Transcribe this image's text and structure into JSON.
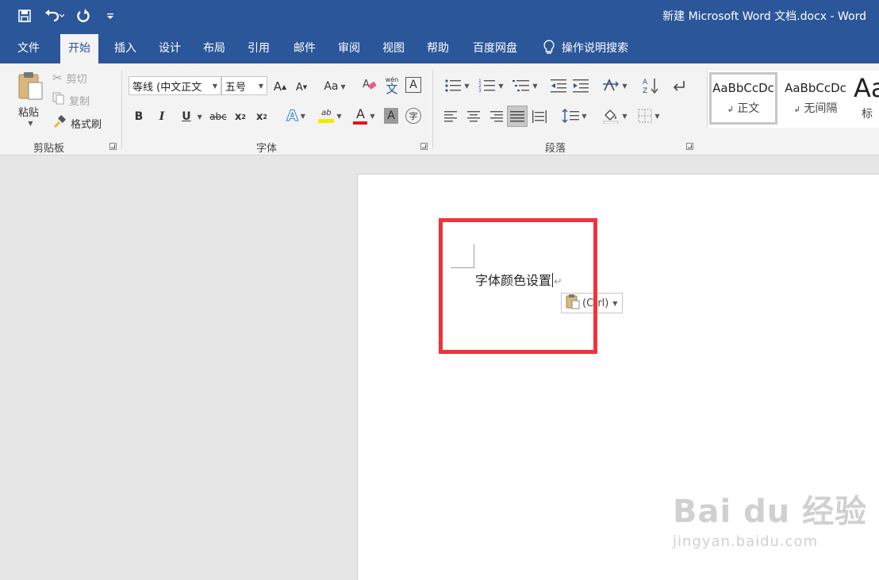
{
  "window": {
    "title": "新建 Microsoft Word 文档.docx  -  Word"
  },
  "tabs": [
    "文件",
    "开始",
    "插入",
    "设计",
    "布局",
    "引用",
    "邮件",
    "审阅",
    "视图",
    "帮助",
    "百度网盘"
  ],
  "active_tab": "开始",
  "tell_me": "操作说明搜索",
  "clipboard": {
    "paste": "粘贴",
    "cut": "剪切",
    "copy": "复制",
    "format_painter": "格式刷",
    "label": "剪贴板"
  },
  "font": {
    "name": "等线 (中文正文",
    "size": "五号",
    "grow": "A",
    "shrink": "A",
    "case": "Aa",
    "phonetic_top": "wén",
    "phonetic_bottom": "文",
    "border_char": "A",
    "bold": "B",
    "italic": "I",
    "underline": "U",
    "strike": "abc",
    "subscript": "x",
    "superscript": "x",
    "sub_mark": "2",
    "sup_mark": "2",
    "effects": "A",
    "highlight": "ab",
    "color": "A",
    "shade": "A",
    "enclose": "字",
    "label": "字体",
    "highlight_color": "#f5e800",
    "font_color": "#e81123"
  },
  "paragraph": {
    "label": "段落"
  },
  "styles": [
    {
      "sample": "AaBbCcDc",
      "name": "正文"
    },
    {
      "sample": "AaBbCcDc",
      "name": "无间隔"
    },
    {
      "sample": "Aa",
      "name": "标"
    }
  ],
  "document": {
    "text": "字体颜色设置",
    "paste_options": "(Ctrl)"
  },
  "watermark": {
    "main": "Bai du 经验",
    "sub": "jingyan.baidu.com"
  },
  "colors": {
    "accent": "#2b579a",
    "highlight_box": "#f0333b"
  }
}
